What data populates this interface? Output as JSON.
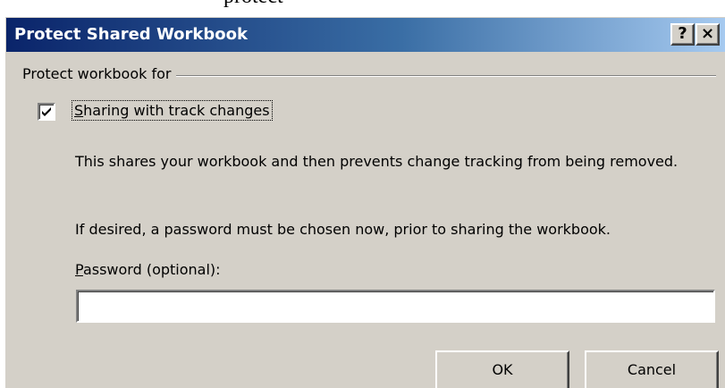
{
  "background_text": "protect",
  "dialog": {
    "title": "Protect Shared Workbook",
    "help_button": "?",
    "close_button": "×",
    "colors": {
      "titlebar_start": "#0a246a",
      "titlebar_end": "#a6caf0",
      "face": "#d4d0c8"
    }
  },
  "group": {
    "label": "Protect workbook for"
  },
  "sharing_checkbox": {
    "checked": true,
    "label_accel": "S",
    "label_rest": "haring with track changes"
  },
  "description": {
    "line1": "This shares your workbook and then prevents change tracking from being removed.",
    "line2": "If desired, a password must be chosen now, prior to sharing the workbook."
  },
  "password": {
    "label_accel": "P",
    "label_rest": "assword (optional):",
    "value": "",
    "placeholder": ""
  },
  "buttons": {
    "ok": "OK",
    "cancel": "Cancel"
  }
}
